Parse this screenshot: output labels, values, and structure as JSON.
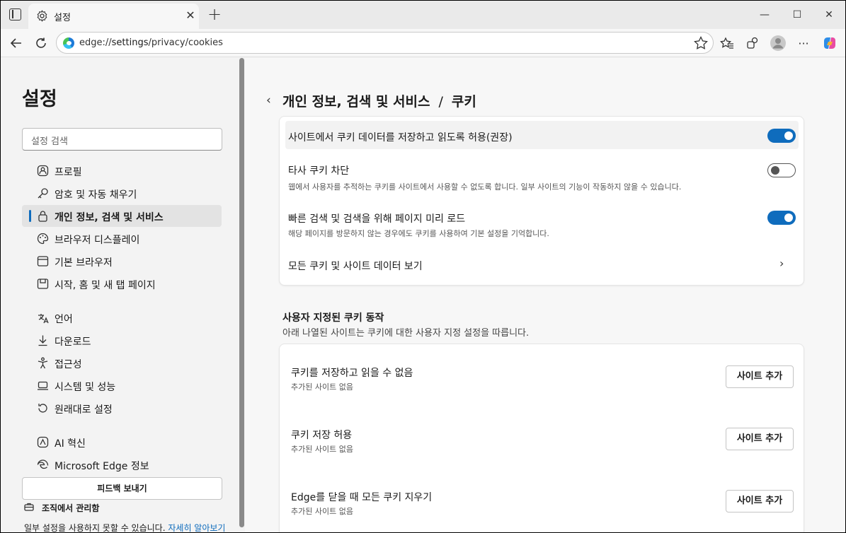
{
  "tab": {
    "title": "설정"
  },
  "window_controls": {
    "minimize": "—",
    "maximize": "☐",
    "close": "✕"
  },
  "address_bar": {
    "prefix": "edge://",
    "host": "settings",
    "path": "/privacy/cookies"
  },
  "sidebar": {
    "title": "설정",
    "search_placeholder": "설정 검색",
    "items": [
      {
        "label": "프로필",
        "icon": "profile-icon"
      },
      {
        "label": "암호 및 자동 채우기",
        "icon": "key-icon"
      },
      {
        "label": "개인 정보, 검색 및 서비스",
        "icon": "lock-icon",
        "active": true
      },
      {
        "label": "브라우저 디스플레이",
        "icon": "palette-icon"
      },
      {
        "label": "기본 브라우저",
        "icon": "browser-icon"
      },
      {
        "label": "시작, 홈 및 새 탭 페이지",
        "icon": "home-page-icon"
      },
      {
        "label": "언어",
        "icon": "language-icon"
      },
      {
        "label": "다운로드",
        "icon": "download-icon"
      },
      {
        "label": "접근성",
        "icon": "accessibility-icon"
      },
      {
        "label": "시스템 및 성능",
        "icon": "laptop-icon"
      },
      {
        "label": "원래대로 설정",
        "icon": "reset-icon"
      },
      {
        "label": "AI 혁신",
        "icon": "ai-icon"
      },
      {
        "label": "Microsoft Edge 정보",
        "icon": "edge-icon"
      }
    ],
    "feedback_label": "피드백 보내기",
    "org_managed": "조직에서 관리함",
    "org_note": "일부 설정을 사용하지 못할 수 있습니다.",
    "org_link": "자세히 알아보기"
  },
  "main": {
    "breadcrumb_parent": "개인 정보, 검색 및 서비스",
    "breadcrumb_separator": "/",
    "breadcrumb_current": "쿠키",
    "settings": [
      {
        "title": "사이트에서 쿠키 데이터를 저장하고 읽도록 허용(권장)",
        "enabled": true
      },
      {
        "title": "타사 쿠키 차단",
        "desc": "웹에서 사용자를 추적하는 쿠키를 사이트에서 사용할 수 없도록 합니다. 일부 사이트의 기능이 작동하지 않을 수 있습니다.",
        "enabled": false
      },
      {
        "title": "빠른 검색 및 검색을 위해 페이지 미리 로드",
        "desc": "해당 페이지를 방문하지 않는 경우에도 쿠키를 사용하여 기본 설정을 기억합니다.",
        "enabled": true
      },
      {
        "title": "모든 쿠키 및 사이트 데이터 보기"
      }
    ],
    "custom_section": {
      "title": "사용자 지정된 쿠키 동작",
      "subtitle": "아래 나열된 사이트는 쿠키에 대한 사용자 지정 설정을 따릅니다.",
      "rules": [
        {
          "title": "쿠키를 저장하고 읽을 수 없음",
          "status": "추가된 사이트 없음",
          "button": "사이트 추가"
        },
        {
          "title": "쿠키 저장 허용",
          "status": "추가된 사이트 없음",
          "button": "사이트 추가"
        },
        {
          "title": "Edge를 닫을 때 모든 쿠키 지우기",
          "status": "추가된 사이트 없음",
          "button": "사이트 추가"
        }
      ]
    }
  },
  "colors": {
    "accent": "#0f6cbd",
    "active_bg": "#e3e3e3"
  }
}
